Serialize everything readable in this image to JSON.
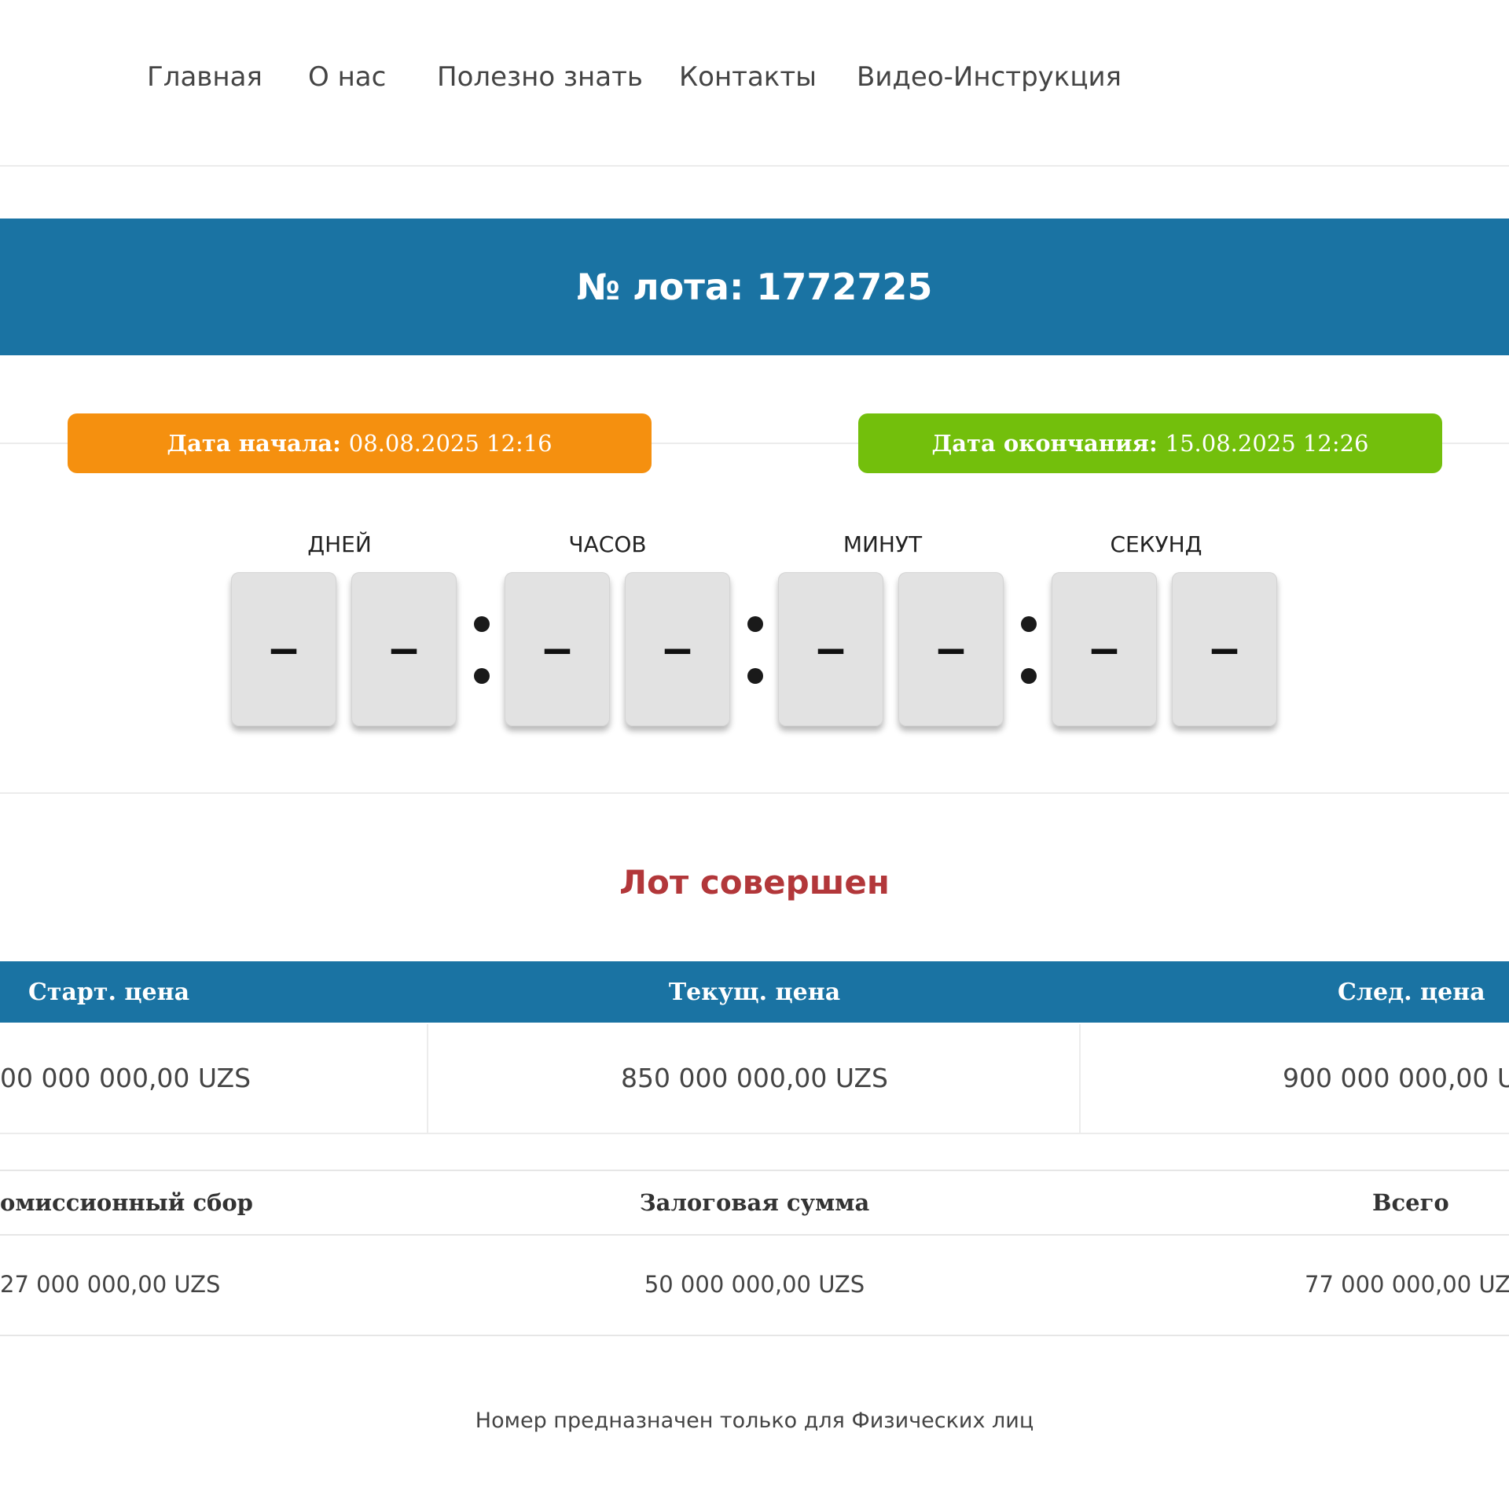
{
  "nav": {
    "items": [
      "Главная",
      "О нас",
      "Полезно знать",
      "Контакты",
      "Видео-Инструкция"
    ]
  },
  "lot": {
    "title": "№ лота: 1772725"
  },
  "dates": {
    "start_label": "Дата начала:",
    "start_value": "08.08.2025 12:16",
    "end_label": "Дата окончания:",
    "end_value": "15.08.2025 12:26",
    "start_color": "#f5900f",
    "end_color": "#73bf0c"
  },
  "countdown": {
    "labels": [
      "ДНЕЙ",
      "ЧАСОВ",
      "МИНУТ",
      "СЕКУНД"
    ],
    "digits": [
      "–",
      "–",
      "–",
      "–",
      "–",
      "–",
      "–",
      "–"
    ]
  },
  "status": {
    "text": "Лот совершен",
    "color": "#b2373a"
  },
  "prices": {
    "headers": [
      "Старт. цена",
      "Текущ. цена",
      "След. цена"
    ],
    "values": [
      "00 000 000,00 UZS",
      "850 000 000,00 UZS",
      "900 000 000,00 UZ"
    ]
  },
  "fees": {
    "headers": [
      "омиссионный сбор",
      "Залоговая сумма",
      "Всего"
    ],
    "values": [
      "27 000 000,00 UZS",
      "50 000 000,00 UZS",
      "77 000 000,00 UZS"
    ]
  },
  "note": {
    "text": "Номер предназначен только для Физических лиц"
  },
  "theme": {
    "primary": "#1a73a3"
  }
}
